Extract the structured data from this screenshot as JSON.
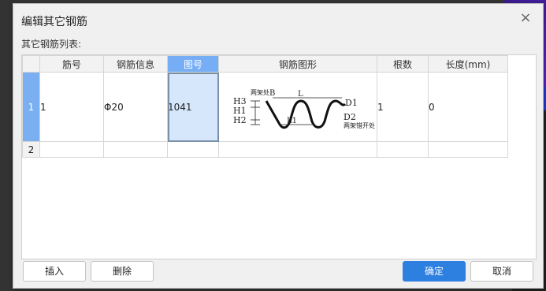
{
  "dialog": {
    "title": "编辑其它钢筋",
    "list_label": "其它钢筋列表:"
  },
  "grid": {
    "columns": [
      "筋号",
      "钢筋信息",
      "图号",
      "钢筋图形",
      "根数",
      "长度(mm)"
    ],
    "selected_column": "图号",
    "rows": [
      {
        "index": "1",
        "bar_no": "1",
        "bar_info": "Φ20",
        "figure_no": "1041",
        "count": "1",
        "length": "0"
      },
      {
        "index": "2",
        "bar_no": "",
        "bar_info": "",
        "figure_no": "",
        "count": "",
        "length": ""
      }
    ],
    "shape_labels": {
      "h3": "H3",
      "h1": "H1",
      "h2": "H2",
      "b": "B",
      "l": "L",
      "l1": "L1",
      "d1": "D1",
      "d2": "D2",
      "top_note": "两架处",
      "bottom_note": "两架错开处"
    }
  },
  "buttons": {
    "insert": "插入",
    "delete": "删除",
    "ok": "确定",
    "cancel": "取消"
  },
  "colors": {
    "accent": "#2d7fe0",
    "selected_header": "#76aef5",
    "focused_cell": "#d6e7fb"
  }
}
